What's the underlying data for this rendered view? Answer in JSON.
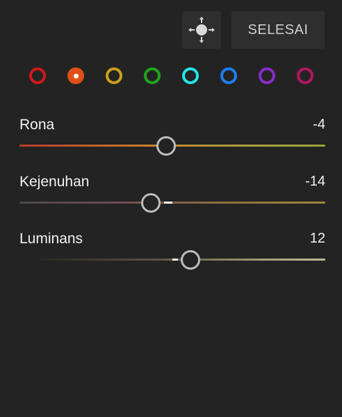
{
  "toolbar": {
    "target_icon": "targeted-adjustment-icon",
    "done_label": "SELESAI"
  },
  "color_swatches": [
    {
      "name": "red",
      "color": "#d01818",
      "selected": false
    },
    {
      "name": "orange",
      "color": "#e04f16",
      "selected": true
    },
    {
      "name": "yellow",
      "color": "#c9a01a",
      "selected": false
    },
    {
      "name": "green",
      "color": "#1fa51f",
      "selected": false
    },
    {
      "name": "aqua",
      "color": "#22e6e6",
      "selected": false
    },
    {
      "name": "blue",
      "color": "#1d7ff2",
      "selected": false
    },
    {
      "name": "purple",
      "color": "#8a2cc9",
      "selected": false
    },
    {
      "name": "magenta",
      "color": "#b3165f",
      "selected": false
    }
  ],
  "sliders": {
    "hue": {
      "label": "Rona",
      "value": "-4",
      "numeric": -4
    },
    "saturation": {
      "label": "Kejenuhan",
      "value": "-14",
      "numeric": -14
    },
    "luminance": {
      "label": "Luminans",
      "value": "12",
      "numeric": 12
    }
  },
  "slider_range": [
    -100,
    100
  ]
}
